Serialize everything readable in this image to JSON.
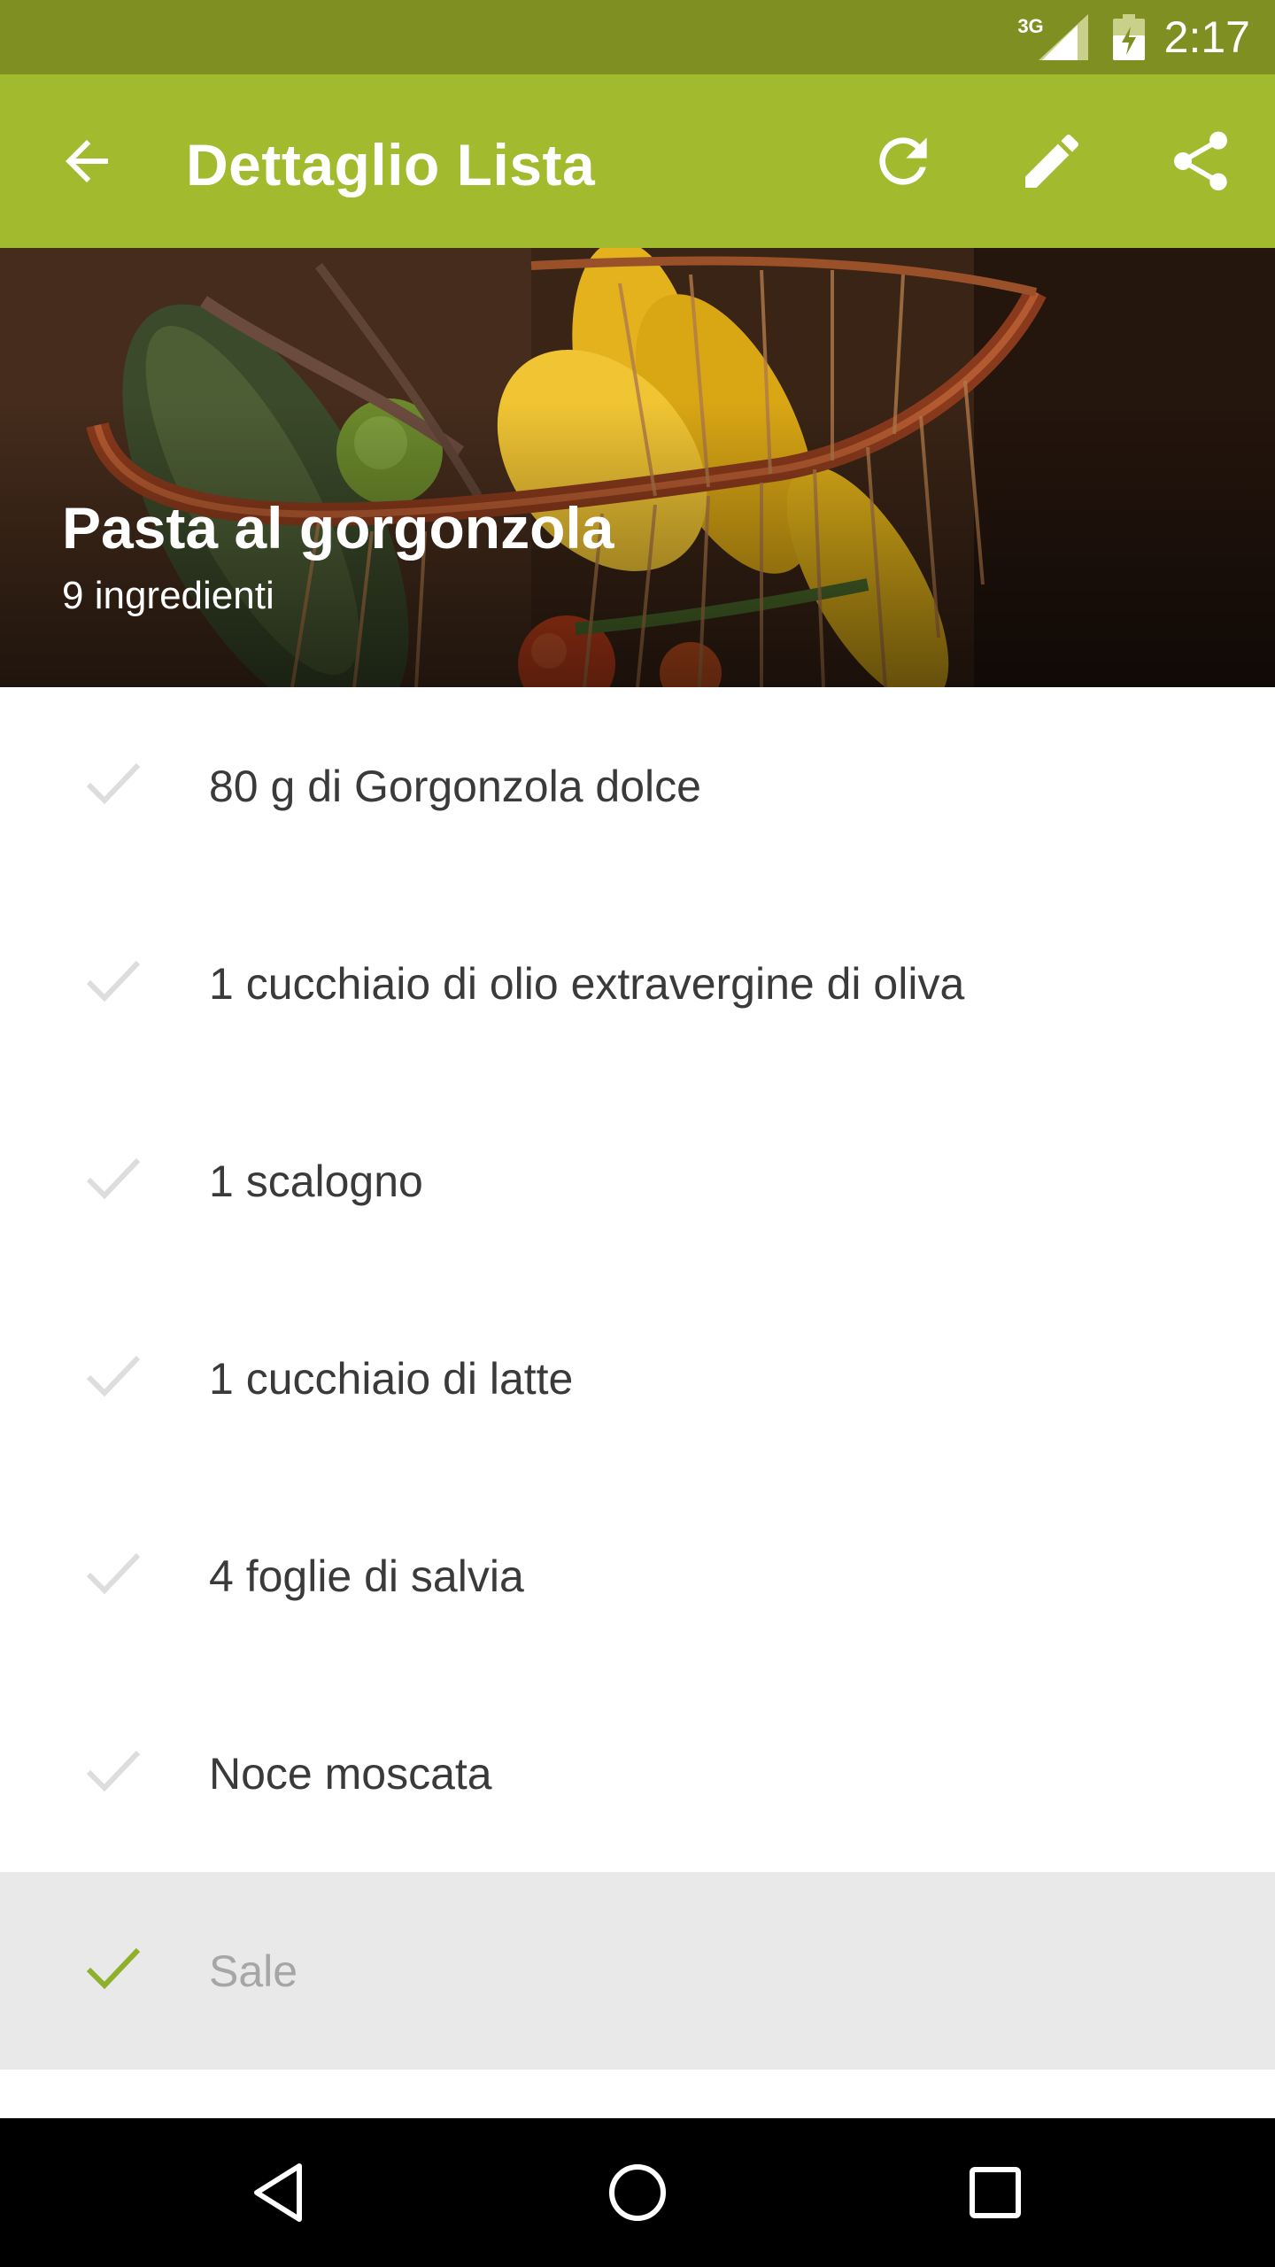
{
  "status_bar": {
    "network": "3G",
    "time": "2:17"
  },
  "app_bar": {
    "title": "Dettaglio Lista",
    "icons": [
      "back-arrow-icon",
      "refresh-icon",
      "edit-pencil-icon",
      "share-icon"
    ]
  },
  "header": {
    "title": "Pasta al gorgonzola",
    "subtitle": "9 ingredienti"
  },
  "ingredients": [
    {
      "label": "80 g di Gorgonzola dolce",
      "checked": false
    },
    {
      "label": "1 cucchiaio di olio extravergine di oliva",
      "checked": false
    },
    {
      "label": "1 scalogno",
      "checked": false
    },
    {
      "label": "1 cucchiaio di latte",
      "checked": false
    },
    {
      "label": "4 foglie di salvia",
      "checked": false
    },
    {
      "label": "Noce moscata",
      "checked": false
    },
    {
      "label": "Sale",
      "checked": true
    }
  ],
  "colors": {
    "status_bar": "#7f8f22",
    "app_bar": "#a2ba2d",
    "check_active": "#8fb02a",
    "check_inactive": "#dddddd",
    "checked_row": "#e9e9e9"
  },
  "nav_bar": {
    "icons": [
      "back-triangle-icon",
      "home-circle-icon",
      "recents-square-icon"
    ]
  }
}
